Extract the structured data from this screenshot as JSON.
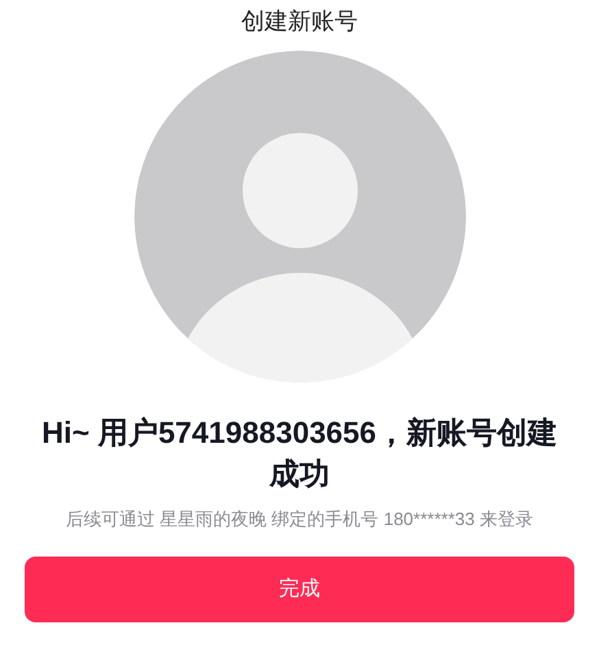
{
  "header": {
    "title": "创建新账号"
  },
  "avatar": {
    "kind": "default"
  },
  "message": {
    "headline": "Hi~ 用户5741988303656，新账号创建成功",
    "detail": "后续可通过 星星雨的夜晚 绑定的手机号 180******33 来登录"
  },
  "buttons": [
    {
      "label": "完成"
    }
  ]
}
